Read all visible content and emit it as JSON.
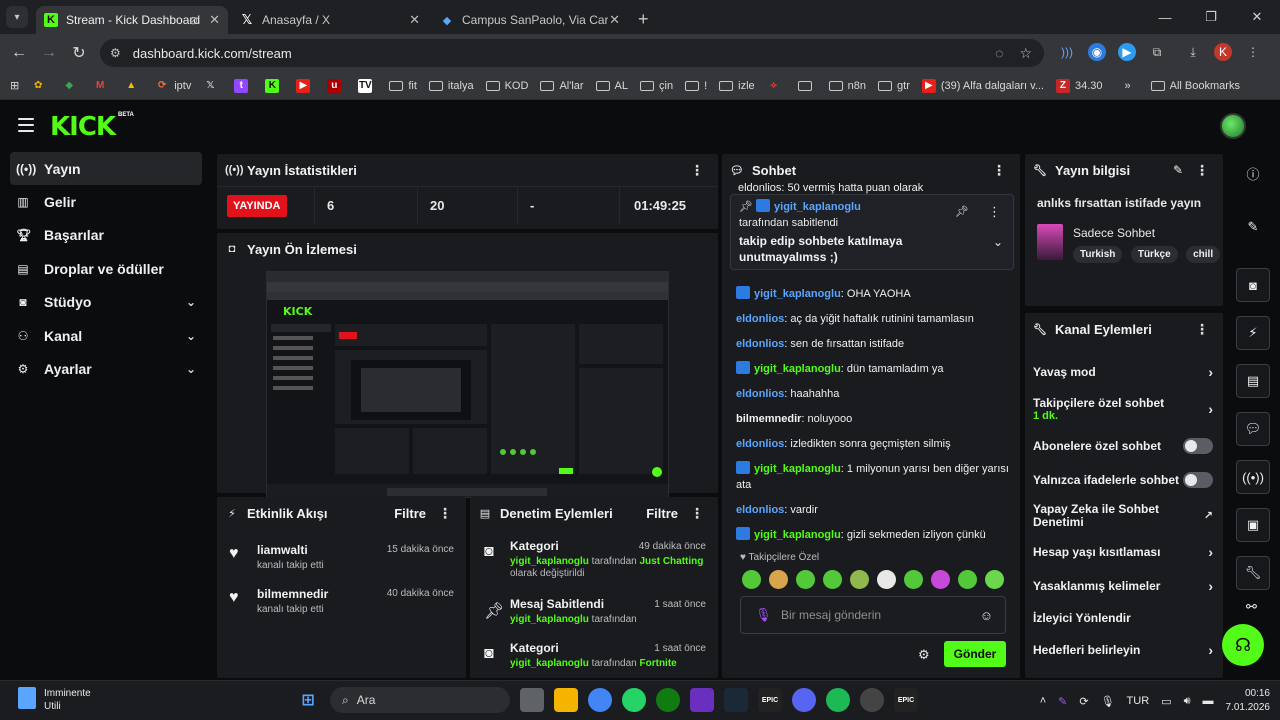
{
  "browser": {
    "tabs": [
      {
        "title": "Stream - Kick Dashboard",
        "active": true
      },
      {
        "title": "Anasayfa / X",
        "active": false
      },
      {
        "title": "Campus SanPaolo, Via Caraglio",
        "active": false
      }
    ],
    "url": "dashboard.kick.com/stream",
    "bookmarks": [
      "iptv",
      "fit",
      "italya",
      "KOD",
      "Al'lar",
      "AL",
      "çin",
      "!",
      "izle",
      "n8n",
      "gtr",
      "(39) Alfa dalgaları v...",
      "34.30"
    ],
    "all_bookmarks": "All Bookmarks"
  },
  "app": {
    "logo": "KICK",
    "beta": "BETA"
  },
  "sidebar": {
    "items": [
      {
        "label": "Yayın",
        "icon": "broadcast-icon",
        "active": true
      },
      {
        "label": "Gelir",
        "icon": "bar-chart-icon"
      },
      {
        "label": "Başarılar",
        "icon": "trophy-icon"
      },
      {
        "label": "Droplar ve ödüller",
        "icon": "gift-icon"
      },
      {
        "label": "Stüdyo",
        "icon": "studio-icon",
        "expandable": true
      },
      {
        "label": "Kanal",
        "icon": "users-icon",
        "expandable": true
      },
      {
        "label": "Ayarlar",
        "icon": "gear-icon",
        "expandable": true
      }
    ]
  },
  "stats": {
    "title": "Yayın İstatistikleri",
    "status": "YAYINDA",
    "viewers": "6",
    "followers": "20",
    "other": "-",
    "duration": "01:49:25"
  },
  "preview": {
    "title": "Yayın Ön İzlemesi"
  },
  "activity": {
    "title": "Etkinlik Akışı",
    "filter": "Filtre",
    "items": [
      {
        "name": "liamwalti",
        "action": "kanalı takip etti",
        "time": "15 dakika önce"
      },
      {
        "name": "bilmemnedir",
        "action": "kanalı takip etti",
        "time": "40 dakika önce"
      }
    ]
  },
  "moderation": {
    "title": "Denetim Eylemleri",
    "filter": "Filtre",
    "items": [
      {
        "title": "Kategori",
        "time": "49 dakika önce",
        "user": "yigit_kaplanoglu",
        "mid": " tarafından ",
        "value": "Just Chatting",
        "suffix": " olarak değiştirildi"
      },
      {
        "title": "Mesaj Sabitlendi",
        "time": "1 saat önce",
        "user": "yigit_kaplanoglu",
        "mid": " tarafından",
        "value": "",
        "suffix": ""
      },
      {
        "title": "Kategori",
        "time": "1 saat önce",
        "user": "yigit_kaplanoglu",
        "mid": " tarafından ",
        "value": "Fortnite",
        "suffix": ""
      }
    ]
  },
  "chat": {
    "title": "Sohbet",
    "top_partial": "eldonlios: 50 vermiş hatta puan olarak",
    "pinned": {
      "user": "yigit_kaplanoglu",
      "by": "tarafından sabitlendi",
      "message": "takip edip sohbete katılmaya unutmayalımss ;)"
    },
    "messages": [
      {
        "user": "yigit_kaplanoglu",
        "color": "blue",
        "badge": true,
        "text": "OHA YAOHA"
      },
      {
        "user": "eldonlios",
        "color": "blue",
        "badge": false,
        "text": "aç da yiğit haftalık rutinini tamamlasın"
      },
      {
        "user": "eldonlios",
        "color": "blue",
        "badge": false,
        "text": "sen de fırsattan istifade"
      },
      {
        "user": "yigit_kaplanoglu",
        "color": "green",
        "badge": true,
        "text": "dün tamamladım ya"
      },
      {
        "user": "eldonlios",
        "color": "blue",
        "badge": false,
        "text": "haahahha"
      },
      {
        "user": "bilmemnedir",
        "color": "white",
        "badge": false,
        "text": "noluyooo"
      },
      {
        "user": "eldonlios",
        "color": "blue",
        "badge": false,
        "text": "izledikten sonra geçmişten silmiş"
      },
      {
        "user": "yigit_kaplanoglu",
        "color": "green",
        "badge": true,
        "text": "1 milyonun yarısı ben diğer yarısı ata"
      },
      {
        "user": "eldonlios",
        "color": "blue",
        "badge": false,
        "text": "vardir"
      },
      {
        "user": "yigit_kaplanoglu",
        "color": "green",
        "badge": true,
        "text": "gizli sekmeden izliyon çünkü"
      }
    ],
    "followers_only": "Takipçilere Özel",
    "input_placeholder": "Bir mesaj gönderin",
    "send": "Gönder"
  },
  "stream_info": {
    "title": "Yayın bilgisi",
    "stream_title": "anlıks fırsattan istifade yayın",
    "category": "Sadece Sohbet",
    "tags": [
      "Turkish",
      "Türkçe",
      "chill"
    ]
  },
  "channel_actions": {
    "title": "Kanal Eylemleri",
    "items": [
      {
        "label": "Yavaş mod",
        "type": "arrow",
        "sub": ""
      },
      {
        "label": "Takipçilere özel sohbet",
        "type": "arrow",
        "sub": "1 dk."
      },
      {
        "label": "Abonelere özel sohbet",
        "type": "toggle",
        "sub": ""
      },
      {
        "label": "Yalnızca ifadelerle sohbet",
        "type": "toggle",
        "sub": ""
      },
      {
        "label": "Yapay Zeka ile Sohbet Denetimi",
        "type": "external",
        "sub": ""
      },
      {
        "label": "Hesap yaşı kısıtlaması",
        "type": "arrow",
        "sub": ""
      },
      {
        "label": "Yasaklanmış kelimeler",
        "type": "arrow",
        "sub": ""
      },
      {
        "label": "İzleyici Yönlendir",
        "type": "none",
        "sub": ""
      },
      {
        "label": "Hedefleri belirleyin",
        "type": "arrow",
        "sub": ""
      }
    ]
  },
  "taskbar": {
    "weather_title": "Imminente",
    "weather_sub": "Utili",
    "search": "Ara",
    "lang": "TUR",
    "time": "00:16",
    "date": "7.01.2026"
  }
}
